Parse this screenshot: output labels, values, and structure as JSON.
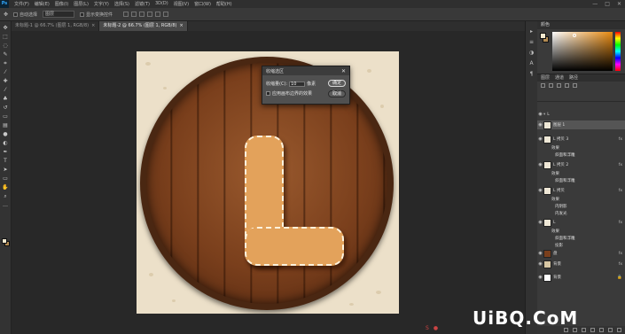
{
  "menu": {
    "logo": "Ps",
    "items": [
      "文件(F)",
      "编辑(E)",
      "图像(I)",
      "图层(L)",
      "文字(Y)",
      "选择(S)",
      "滤镜(T)",
      "3D(D)",
      "视图(V)",
      "窗口(W)",
      "帮助(H)"
    ],
    "window_controls": [
      "—",
      "□",
      "✕"
    ]
  },
  "options": {
    "auto_select_label": "自动选择",
    "layer_chip": "图层",
    "show_transform_label": "显示变换控件"
  },
  "tabs": [
    {
      "label": "未标题-1 @ 66.7% (图层 1, RGB/8)",
      "close": "×"
    },
    {
      "label": "未标题-2 @ 66.7% (图层 1, RGB/8)",
      "close": "×"
    }
  ],
  "dialog": {
    "title": "收缩选区",
    "close": "✕",
    "amount_label": "收缩量(C):",
    "amount_value": "10",
    "unit": "像素",
    "apply_canvas_label": "应用画布边界的效果",
    "ok_label": "确定",
    "cancel_label": "取消"
  },
  "color_panel": {
    "title": "颜色"
  },
  "layers_panel": {
    "tabs": [
      "图层",
      "通道",
      "路径"
    ],
    "rows": [
      {
        "name": "L",
        "fx": ""
      },
      {
        "name": "图层 1",
        "fx": ""
      },
      {
        "name": "L 拷贝 3",
        "fx": "fx"
      },
      {
        "name": "效果",
        "fx": ""
      },
      {
        "name": "斜面和浮雕",
        "fx": ""
      },
      {
        "name": "L 拷贝 2",
        "fx": "fx"
      },
      {
        "name": "效果",
        "fx": ""
      },
      {
        "name": "斜面和浮雕",
        "fx": ""
      },
      {
        "name": "L 拷贝",
        "fx": "fx"
      },
      {
        "name": "效果",
        "fx": ""
      },
      {
        "name": "内阴影",
        "fx": ""
      },
      {
        "name": "内发光",
        "fx": ""
      },
      {
        "name": "L",
        "fx": "fx"
      },
      {
        "name": "效果",
        "fx": ""
      },
      {
        "name": "斜面和浮雕",
        "fx": ""
      },
      {
        "name": "投影",
        "fx": ""
      },
      {
        "name": "盘",
        "fx": "fx"
      },
      {
        "name": "背景",
        "fx": "fx"
      },
      {
        "name": "背景",
        "fx": ""
      }
    ]
  },
  "watermark": "UiBQ.CoM",
  "colors": {
    "foreground": "#f3e9cf",
    "background": "#b38b52",
    "letter": "#e3a25b",
    "wood": "#7a3f1c"
  }
}
